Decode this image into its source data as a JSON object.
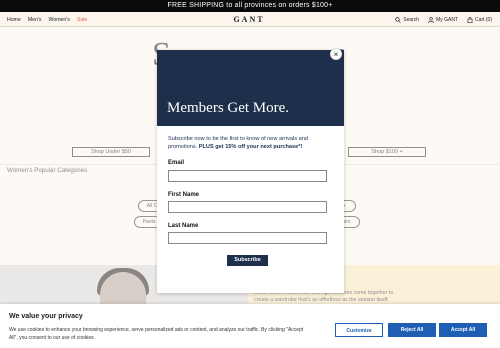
{
  "promo": {
    "text": "FREE SHIPPING to all provinces on orders $100+"
  },
  "header": {
    "nav": [
      "Home",
      "Men's",
      "Women's",
      "Sale"
    ],
    "logo": "GANT",
    "search": "Search",
    "account": "My GANT",
    "cart": "Cart (0)"
  },
  "hero": {
    "left_glyph": "S",
    "right_glyph": "c",
    "button_left": "Shop Under $50",
    "button_right": "Shop $100 +"
  },
  "categories": {
    "title": "Women's Popular Categories",
    "chips": [
      "All C",
      "ers",
      "Pants",
      "pairs"
    ]
  },
  "editorial": {
    "text_line1": "Clean lines, relaxed fits, and light textures come together to",
    "text_line2": "create a wardrobe that's as effortless as the season itself."
  },
  "modal": {
    "close": "×",
    "banner_title": "Members Get More.",
    "intro_plain": "Subscribe now to be the first to know of new arrivals and promotions. ",
    "intro_bold": "PLUS get 15% off your next purchase*!",
    "email_label": "Email",
    "first_name_label": "First Name",
    "last_name_label": "Last Name",
    "subscribe": "Subscribe"
  },
  "cookie": {
    "title": "We value your privacy",
    "text": "We use cookies to enhance your browsing experience, serve personalized ads or content, and analyze our traffic. By clicking \"Accept All\", you consent to our use of cookies.",
    "customize": "Customize",
    "reject": "Reject All",
    "accept": "Accept All"
  }
}
